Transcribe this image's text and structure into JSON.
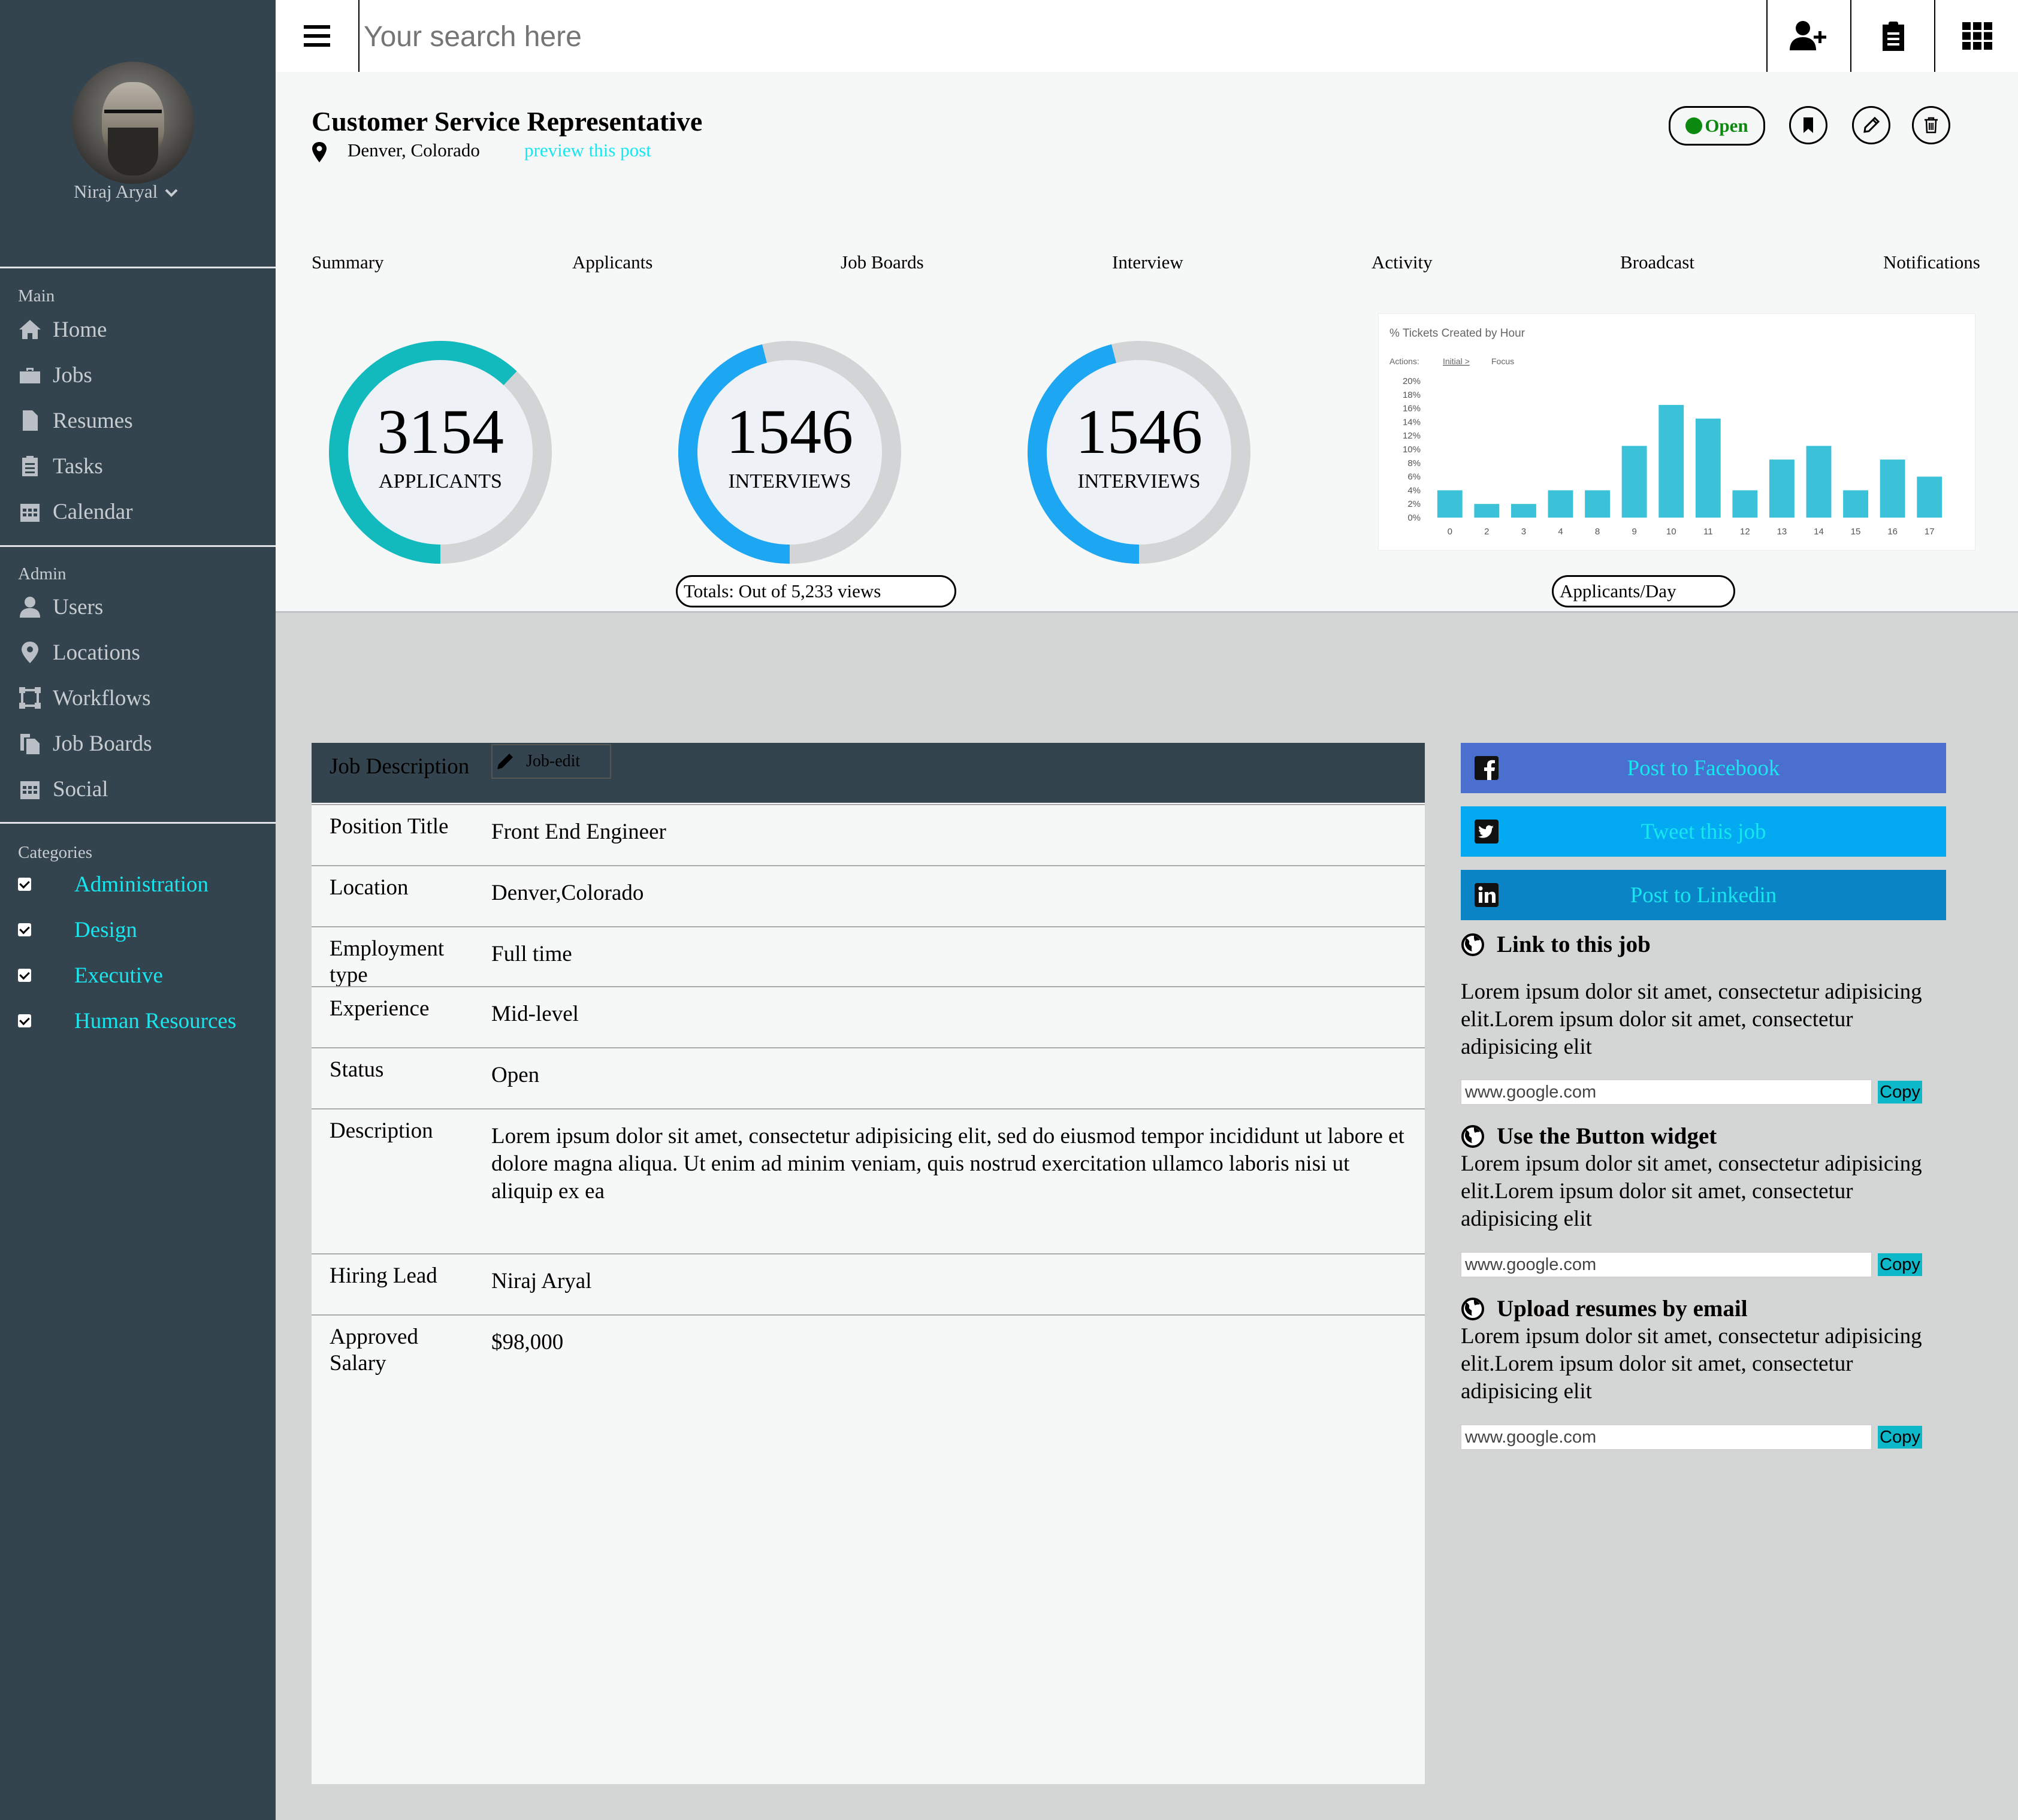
{
  "user": {
    "name": "Niraj Aryal"
  },
  "sidebar": {
    "main_heading": "Main",
    "main_items": [
      {
        "label": "Home",
        "icon": "home-icon"
      },
      {
        "label": "Jobs",
        "icon": "briefcase-icon"
      },
      {
        "label": "Resumes",
        "icon": "file-icon"
      },
      {
        "label": "Tasks",
        "icon": "clipboard-icon"
      },
      {
        "label": "Calendar",
        "icon": "calendar-icon"
      }
    ],
    "admin_heading": "Admin",
    "admin_items": [
      {
        "label": "Users",
        "icon": "user-icon"
      },
      {
        "label": "Locations",
        "icon": "map-pin-icon"
      },
      {
        "label": "Workflows",
        "icon": "workflow-icon"
      },
      {
        "label": "Job Boards",
        "icon": "copy-icon"
      },
      {
        "label": "Social",
        "icon": "calendar-icon"
      }
    ],
    "categories_heading": "Categories",
    "categories": [
      {
        "label": "Administration",
        "checked": true
      },
      {
        "label": "Design",
        "checked": true
      },
      {
        "label": "Executive",
        "checked": true
      },
      {
        "label": "Human Resources",
        "checked": true
      }
    ]
  },
  "topbar": {
    "search_placeholder": "Your search here"
  },
  "job": {
    "title": "Customer Service Representative",
    "location": "Denver, Colorado",
    "preview_link": "preview this post",
    "status": "Open",
    "status_color": "#0c8a10"
  },
  "tabs": [
    "Summary",
    "Applicants",
    "Job Boards",
    "Interview",
    "Activity",
    "Broadcast",
    "Notifications"
  ],
  "stats": [
    {
      "number": "3154",
      "label": "APPLICANTS",
      "progress": 0.62,
      "color": "#12b9bd"
    },
    {
      "number": "1546",
      "label": "INTERVIEWS",
      "progress": 0.46,
      "color": "#1da6f2"
    },
    {
      "number": "1546",
      "label": "INTERVIEWS",
      "progress": 0.46,
      "color": "#1da6f2"
    }
  ],
  "totals_label": "Totals: Out of 5,233 views",
  "applicants_day_label": "Applicants/Day",
  "chart_data": {
    "type": "bar",
    "title": "% Tickets Created by Hour",
    "actions_label": "Actions:",
    "actions": [
      "Initial >",
      "Focus"
    ],
    "categories": [
      "0",
      "2",
      "3",
      "4",
      "8",
      "9",
      "10",
      "11",
      "12",
      "13",
      "14",
      "15",
      "16",
      "17"
    ],
    "values": [
      4,
      2,
      2,
      4,
      4,
      10.5,
      16.5,
      14.5,
      4,
      8.5,
      10.5,
      4,
      8.5,
      6
    ],
    "ylim": [
      0,
      20
    ],
    "yticks": [
      "20%",
      "18%",
      "16%",
      "14%",
      "12%",
      "10%",
      "8%",
      "6%",
      "4%",
      "2%",
      "0%"
    ],
    "bar_color": "#3cc2d8"
  },
  "job_table": {
    "header_label": "Job Description",
    "edit_label": "Job-edit",
    "rows": [
      {
        "label": "Position Title",
        "value": "Front End Engineer"
      },
      {
        "label": "Location",
        "value": "Denver,Colorado"
      },
      {
        "label": "Employment type",
        "value": "Full time"
      },
      {
        "label": "Experience",
        "value": "Mid-level"
      },
      {
        "label": "Status",
        "value": "Open"
      },
      {
        "label": "Description",
        "value": "Lorem ipsum dolor sit amet, consectetur adipisicing elit, sed do eiusmod tempor incididunt ut labore et dolore magna aliqua. Ut enim ad minim veniam, quis nostrud exercitation ullamco laboris nisi ut aliquip ex ea"
      },
      {
        "label": "Hiring Lead",
        "value": "Niraj Aryal"
      },
      {
        "label": "Approved Salary",
        "value": "$98,000"
      }
    ]
  },
  "share": [
    {
      "label": "Post to Facebook",
      "icon": "facebook-icon",
      "color": "#4a6fcf"
    },
    {
      "label": "Tweet this job",
      "icon": "twitter-icon",
      "color": "#03a9f1"
    },
    {
      "label": "Post to Linkedin",
      "icon": "linkedin-icon",
      "color": "#0b84c6"
    }
  ],
  "sections": [
    {
      "heading": "Link to this job",
      "text": "Lorem ipsum dolor sit amet, consectetur adipisicing elit.Lorem ipsum dolor sit amet, consectetur adipisicing elit",
      "url": "www.google.com",
      "copy": "Copy"
    },
    {
      "heading": "Use the Button widget",
      "text": "Lorem ipsum dolor sit amet, consectetur adipisicing elit.Lorem ipsum dolor sit amet, consectetur adipisicing elit",
      "url": "www.google.com",
      "copy": "Copy"
    },
    {
      "heading": "Upload resumes by email",
      "text": "Lorem ipsum dolor sit amet, consectetur adipisicing elit.Lorem ipsum dolor sit amet, consectetur adipisicing elit",
      "url": "www.google.com",
      "copy": "Copy"
    }
  ]
}
